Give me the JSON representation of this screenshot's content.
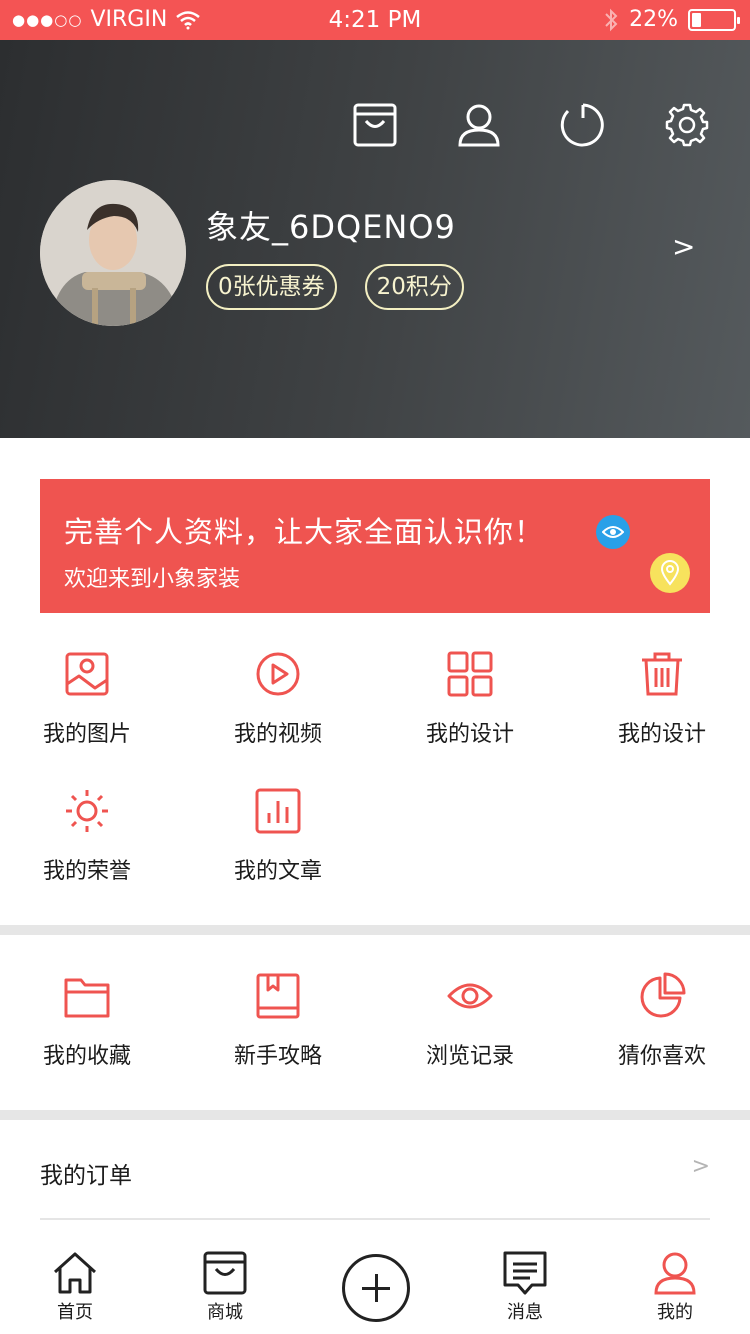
{
  "status_bar": {
    "signal": "●●●○○",
    "carrier": "VIRGIN",
    "time": "4:21 PM",
    "battery": "22%",
    "battery_level": 0.22
  },
  "header": {
    "icons": [
      "shopping-bag-icon",
      "user-icon",
      "refresh-icon",
      "gear-icon"
    ],
    "username": "象友_6DQENO9",
    "coupons": "0张优惠券",
    "points": "20积分",
    "arrow": ">"
  },
  "banner": {
    "title": "完善个人资料，让大家全面认识你！",
    "subtitle": "欢迎来到小象家装",
    "color": "#ef5450"
  },
  "grid1": {
    "items": [
      {
        "label": "我的图片",
        "icon": "image-icon"
      },
      {
        "label": "我的视频",
        "icon": "play-icon"
      },
      {
        "label": "我的设计",
        "icon": "grid-icon"
      },
      {
        "label": "我的设计",
        "icon": "trash-icon"
      },
      {
        "label": "我的荣誉",
        "icon": "sun-icon"
      },
      {
        "label": "我的文章",
        "icon": "chart-icon"
      }
    ]
  },
  "grid2": {
    "items": [
      {
        "label": "我的收藏",
        "icon": "folder-icon"
      },
      {
        "label": "新手攻略",
        "icon": "book-icon"
      },
      {
        "label": "浏览记录",
        "icon": "eye-icon"
      },
      {
        "label": "猜你喜欢",
        "icon": "pie-icon"
      }
    ]
  },
  "orders": {
    "label": "我的订单",
    "arrow": ">"
  },
  "tabbar": {
    "items": [
      {
        "label": "首页",
        "icon": "home-icon"
      },
      {
        "label": "商城",
        "icon": "store-icon"
      },
      {
        "label": "",
        "icon": "plus-icon"
      },
      {
        "label": "消息",
        "icon": "message-icon"
      },
      {
        "label": "我的",
        "icon": "profile-icon",
        "active": true
      }
    ]
  },
  "colors": {
    "accent": "#ef5450",
    "status_bar": "#f45454",
    "badge_border": "#f3efc2"
  }
}
